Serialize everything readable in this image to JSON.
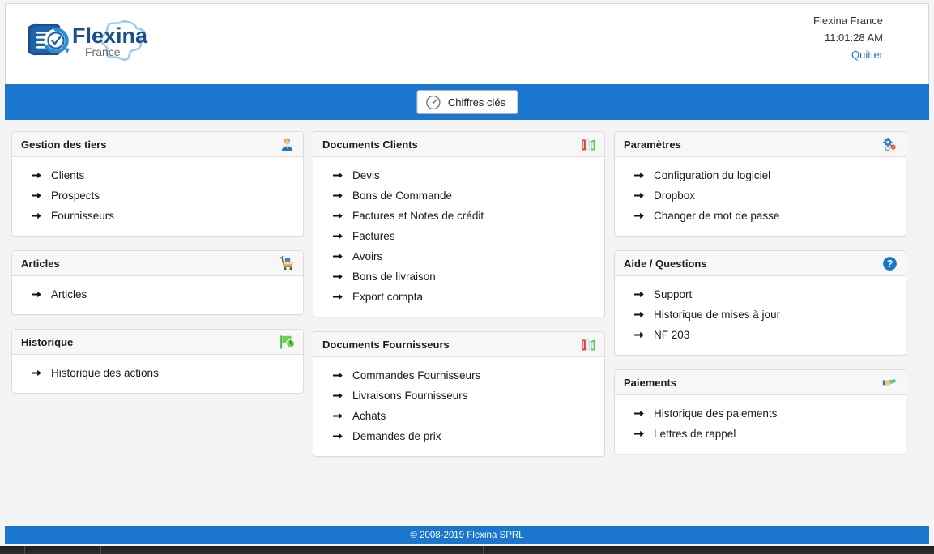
{
  "header": {
    "logo_primary": "Flexina",
    "logo_secondary": "France",
    "user_name": "Flexina France",
    "clock": "11:01:28 AM",
    "quit_label": "Quitter"
  },
  "navbar": {
    "key_figures_label": "Chiffres clés",
    "key_figures_icon": "gauge-icon",
    "background_color": "#1b76cf"
  },
  "columns": [
    {
      "panels": [
        {
          "title": "Gestion des tiers",
          "icon": "user-icon",
          "items": [
            {
              "label": "Clients"
            },
            {
              "label": "Prospects"
            },
            {
              "label": "Fournisseurs"
            }
          ]
        },
        {
          "title": "Articles",
          "icon": "shopping-cart-icon",
          "items": [
            {
              "label": "Articles"
            }
          ]
        },
        {
          "title": "Historique",
          "icon": "history-flag-icon",
          "items": [
            {
              "label": "Historique des actions"
            }
          ]
        }
      ]
    },
    {
      "panels": [
        {
          "title": "Documents Clients",
          "icon": "binders-icon",
          "items": [
            {
              "label": "Devis"
            },
            {
              "label": "Bons de Commande"
            },
            {
              "label": "Factures et Notes de crédit"
            },
            {
              "label": "Factures"
            },
            {
              "label": "Avoirs"
            },
            {
              "label": "Bons de livraison"
            },
            {
              "label": "Export compta"
            }
          ]
        },
        {
          "title": "Documents Fournisseurs",
          "icon": "binders-icon",
          "items": [
            {
              "label": "Commandes Fournisseurs"
            },
            {
              "label": "Livraisons Fournisseurs"
            },
            {
              "label": "Achats"
            },
            {
              "label": "Demandes de prix"
            }
          ]
        }
      ]
    },
    {
      "panels": [
        {
          "title": "Paramètres",
          "icon": "gears-icon",
          "items": [
            {
              "label": "Configuration du logiciel"
            },
            {
              "label": "Dropbox"
            },
            {
              "label": "Changer de mot de passe"
            }
          ]
        },
        {
          "title": "Aide / Questions",
          "icon": "help-circle-icon",
          "items": [
            {
              "label": "Support"
            },
            {
              "label": "Historique de mises à jour"
            },
            {
              "label": "NF 203"
            }
          ]
        },
        {
          "title": "Paiements",
          "icon": "money-hand-icon",
          "items": [
            {
              "label": "Historique des paiements"
            },
            {
              "label": "Lettres de rappel"
            }
          ]
        }
      ]
    }
  ],
  "footer": {
    "copyright": "© 2008-2019 Flexina SPRL"
  },
  "colors": {
    "accent_blue": "#1b76cf",
    "link_blue": "#1b76cf",
    "panel_header_bg": "#f7f7f7",
    "page_bg": "#f4f4f4"
  }
}
